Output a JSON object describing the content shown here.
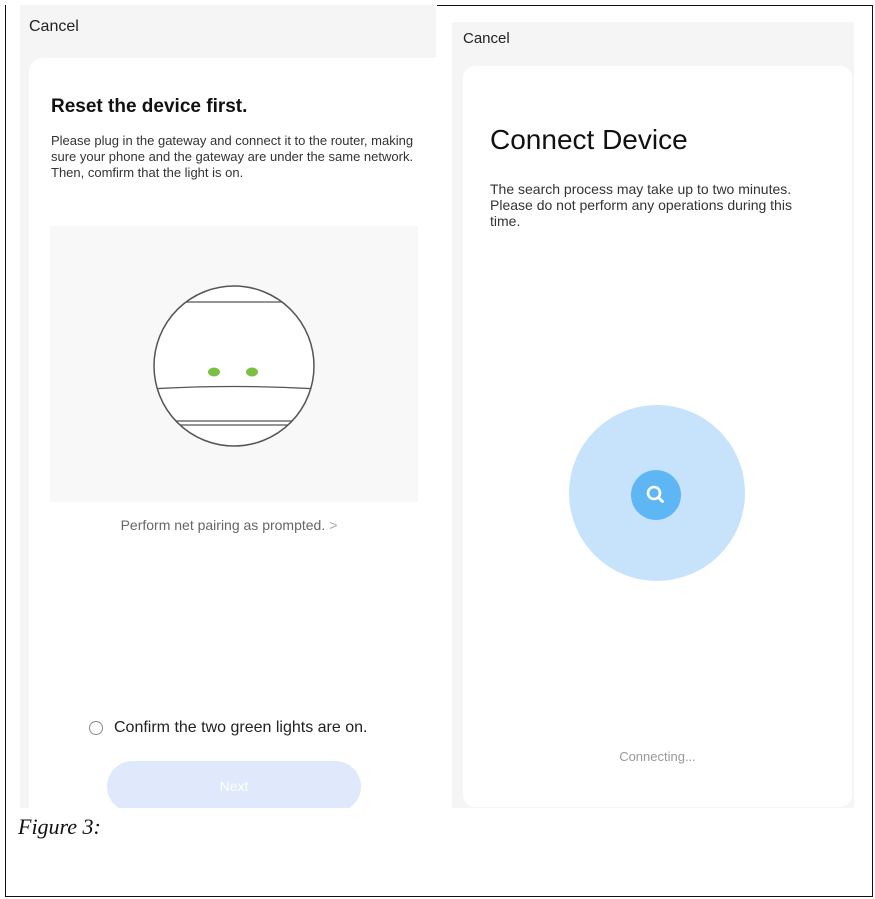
{
  "left_screen": {
    "cancel_label": "Cancel",
    "title": "Reset the device first.",
    "description": "Please plug in the gateway and connect it to the router, making sure your phone and the gateway are under the same network. Then, comfirm that the light is on.",
    "pairing_link": "Perform net pairing as prompted.",
    "pairing_chevron": ">",
    "confirm_label": "Confirm the two green lights are on.",
    "confirm_checked": false,
    "next_label": "Next",
    "indicator_color": "#7ac143"
  },
  "right_screen": {
    "cancel_label": "Cancel",
    "title": "Connect Device",
    "description": "The search process may take up to two minutes. Please do not perform any operations during this time.",
    "status": "Connecting...",
    "search_icon": "search-icon",
    "accent_color": "#5fb6f5"
  },
  "caption": "Figure 3:"
}
